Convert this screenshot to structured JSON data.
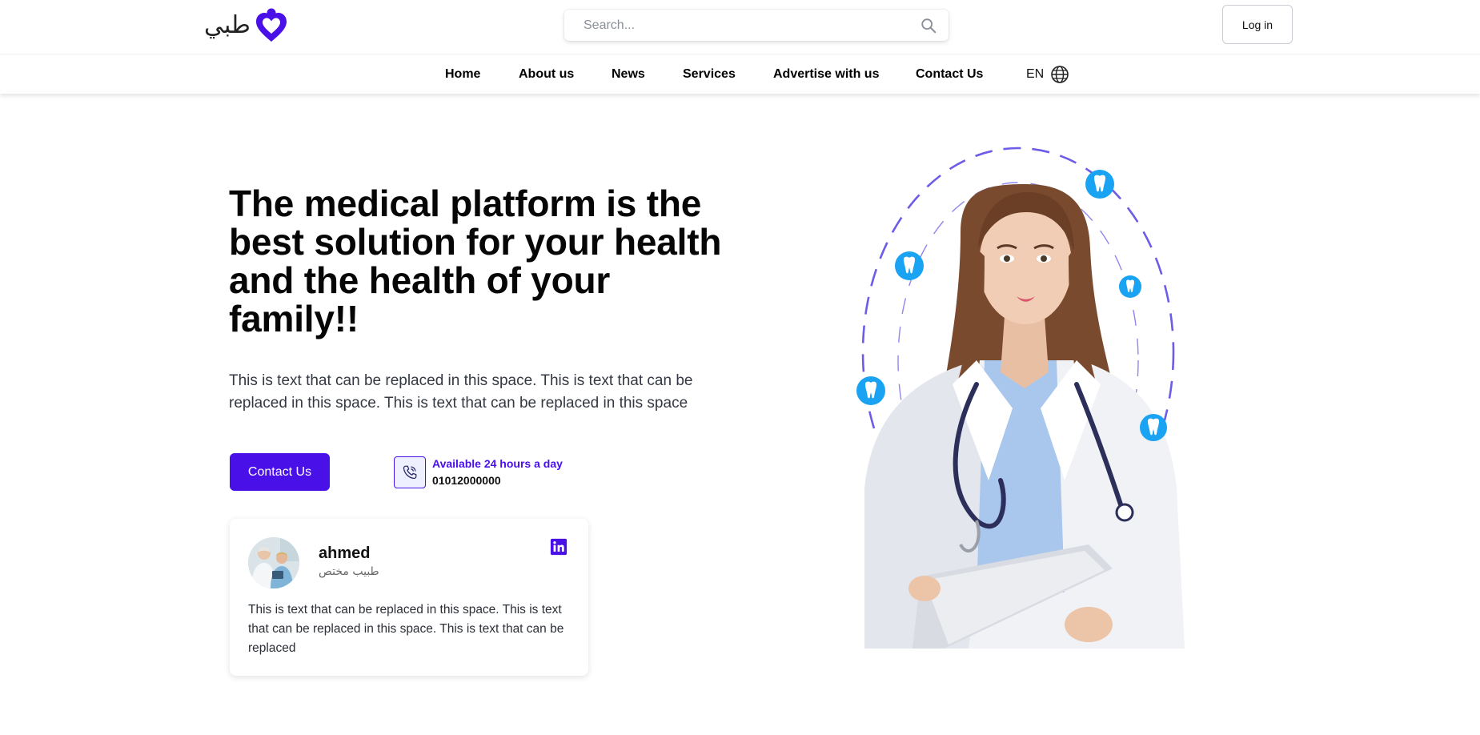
{
  "brand": {
    "logo_text": "طبي"
  },
  "search": {
    "placeholder": "Search..."
  },
  "header": {
    "login_label": "Log in"
  },
  "nav": {
    "items": [
      {
        "label": "Home"
      },
      {
        "label": "About us"
      },
      {
        "label": "News"
      },
      {
        "label": "Services"
      },
      {
        "label": "Advertise with us"
      },
      {
        "label": "Contact Us"
      }
    ],
    "language": "EN"
  },
  "hero": {
    "title": "The medical platform is the best solution for your health and the health of your family!!",
    "description": "This is text that can be replaced in this space. This is text that can be replaced in this space. This is text that can be replaced in this space",
    "cta_label": "Contact Us",
    "availability": "Available 24 hours a day",
    "phone": "01012000000"
  },
  "doctor_card": {
    "name": "ahmed",
    "title": "طبيب مختص",
    "text": "This is text that can be replaced in this space. This is text that can be replaced in this space. This is text that can be replaced"
  },
  "colors": {
    "primary": "#4a10e8",
    "accent_blue": "#1aa3f2",
    "dashed_ring": "#6c5ce7",
    "text_dark": "#060606",
    "text_body": "#333842"
  },
  "icons": [
    "logo-heart-icon",
    "search-icon",
    "globe-icon",
    "phone-icon",
    "linkedin-icon",
    "tooth-icon"
  ]
}
